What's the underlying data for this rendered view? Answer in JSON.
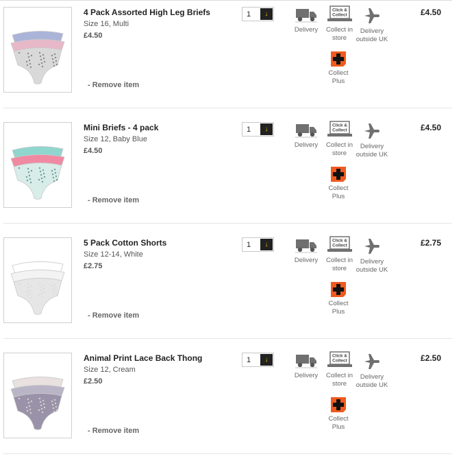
{
  "basket": {
    "items": [
      {
        "title": "4 Pack Assorted High Leg Briefs",
        "variant": "Size 16, Multi",
        "unit_price": "£4.50",
        "quantity": "1",
        "line_price": "£4.50",
        "remove_label": "- Remove item",
        "image_palette": [
          "#aab4d8",
          "#e7b8c8",
          "#d9d9d9",
          "#8a8a8a"
        ]
      },
      {
        "title": "Mini Briefs - 4 pack",
        "variant": "Size 12, Baby Blue",
        "unit_price": "£4.50",
        "quantity": "1",
        "line_price": "£4.50",
        "remove_label": "- Remove item",
        "image_palette": [
          "#8fd6cf",
          "#f08aa3",
          "#d8ece8",
          "#6f9f9a"
        ]
      },
      {
        "title": "5 Pack Cotton Shorts",
        "variant": "Size 12-14, White",
        "unit_price": "£2.75",
        "quantity": "1",
        "line_price": "£2.75",
        "remove_label": "- Remove item",
        "image_palette": [
          "#ffffff",
          "#f3f3f3",
          "#e6e6e6",
          "#dcdcdc"
        ]
      },
      {
        "title": "Animal Print Lace Back Thong",
        "variant": "Size 12, Cream",
        "unit_price": "£2.50",
        "quantity": "1",
        "line_price": "£2.50",
        "remove_label": "- Remove item",
        "image_palette": [
          "#e9e0e0",
          "#b9b4c6",
          "#9a92a8",
          "#d8d2d2"
        ]
      }
    ],
    "delivery_options": {
      "delivery": "Delivery",
      "collect_line1": "Collect in",
      "collect_line2": "store",
      "outside_line1": "Delivery",
      "outside_line2": "outside UK",
      "plus_line1": "Collect",
      "plus_line2": "Plus",
      "click_collect_icon_text_1": "Click &",
      "click_collect_icon_text_2": "Collect"
    },
    "colors": {
      "accent": "#f2c200",
      "collect_plus": "#f05a1e",
      "icon_grey": "#707070"
    }
  }
}
